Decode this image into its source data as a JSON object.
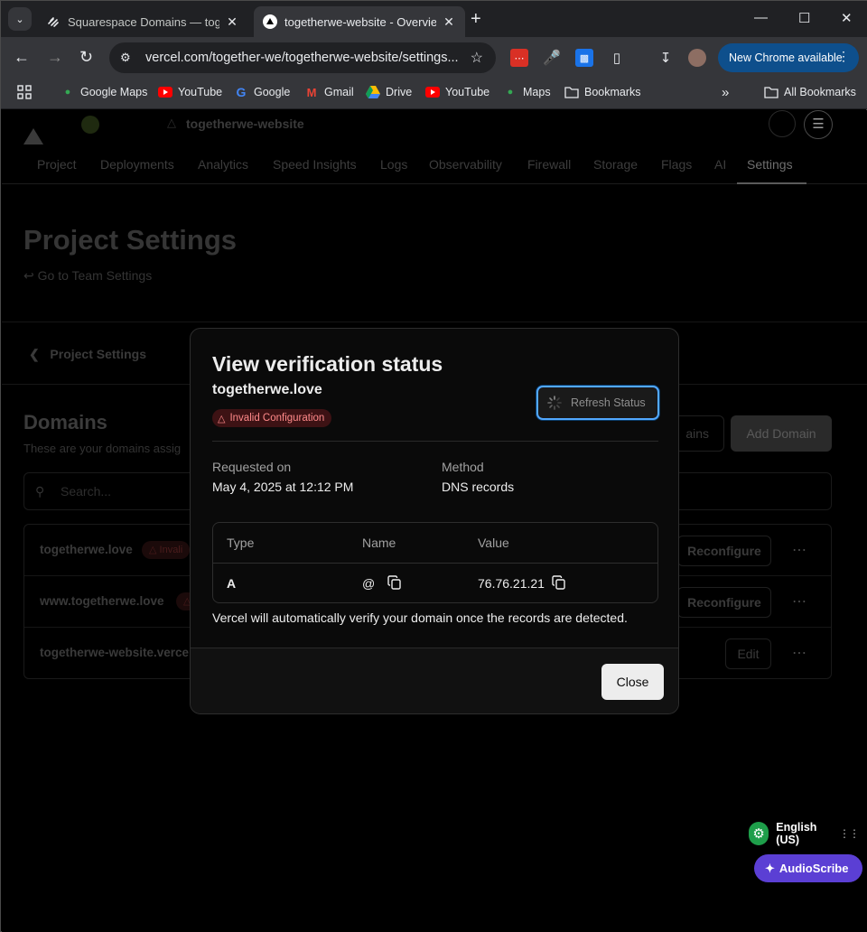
{
  "browser": {
    "tabs": [
      {
        "title": "Squarespace Domains — togeth",
        "active": false
      },
      {
        "title": "togetherwe-website - Overview",
        "active": true
      }
    ],
    "url": "vercel.com/together-we/togetherwe-website/settings...",
    "update_button": "New Chrome available",
    "bookmarks": [
      {
        "label": "Google Maps",
        "icon": "maps-pin-icon"
      },
      {
        "label": "YouTube",
        "icon": "youtube-icon"
      },
      {
        "label": "Google",
        "icon": "google-icon"
      },
      {
        "label": "Gmail",
        "icon": "gmail-icon"
      },
      {
        "label": "Drive",
        "icon": "drive-icon"
      },
      {
        "label": "YouTube",
        "icon": "youtube-icon"
      },
      {
        "label": "Maps",
        "icon": "maps-pin-icon"
      },
      {
        "label": "Bookmarks",
        "icon": "folder-icon"
      }
    ],
    "all_bookmarks": "All Bookmarks"
  },
  "project": {
    "name": "togetherwe-website",
    "nav_tabs": [
      "Project",
      "Deployments",
      "Analytics",
      "Speed Insights",
      "Logs",
      "Observability",
      "Firewall",
      "Storage",
      "Flags",
      "AI",
      "Settings"
    ],
    "active_tab": "Settings",
    "page_title": "Project Settings",
    "team_link": "Go to Team Settings",
    "back_link": "Project Settings",
    "domains_heading": "Domains",
    "domains_sub": "These are your domains assig",
    "btn_domains_partial": "ains",
    "btn_add_domain": "Add Domain",
    "search_placeholder": "Search...",
    "domains": [
      {
        "name": "togetherwe.love",
        "badge": "Invali",
        "action": "Reconfigure"
      },
      {
        "name": "www.togetherwe.love",
        "badge": "",
        "action": "Reconfigure"
      },
      {
        "name": "togetherwe-website.verce",
        "badge": "",
        "action": "Edit"
      }
    ]
  },
  "modal": {
    "title": "View verification status",
    "domain": "togetherwe.love",
    "status_badge": "Invalid Configuration",
    "refresh_button": "Refresh Status",
    "requested_label": "Requested on",
    "requested_value": "May 4, 2025 at 12:12 PM",
    "method_label": "Method",
    "method_value": "DNS records",
    "table": {
      "headers": [
        "Type",
        "Name",
        "Value"
      ],
      "row": {
        "type": "A",
        "name": "@",
        "value": "76.76.21.21"
      }
    },
    "note": "Vercel will automatically verify your domain once the records are detected.",
    "close_button": "Close"
  },
  "widgets": {
    "language": "English (US)",
    "audioscribe": "AudioScribe"
  },
  "colors": {
    "accent_blue": "#52a8ff",
    "error_red": "#ff8a8a",
    "chrome_update": "#0e4f8c",
    "audioscribe_purple": "#5b3fd4"
  }
}
